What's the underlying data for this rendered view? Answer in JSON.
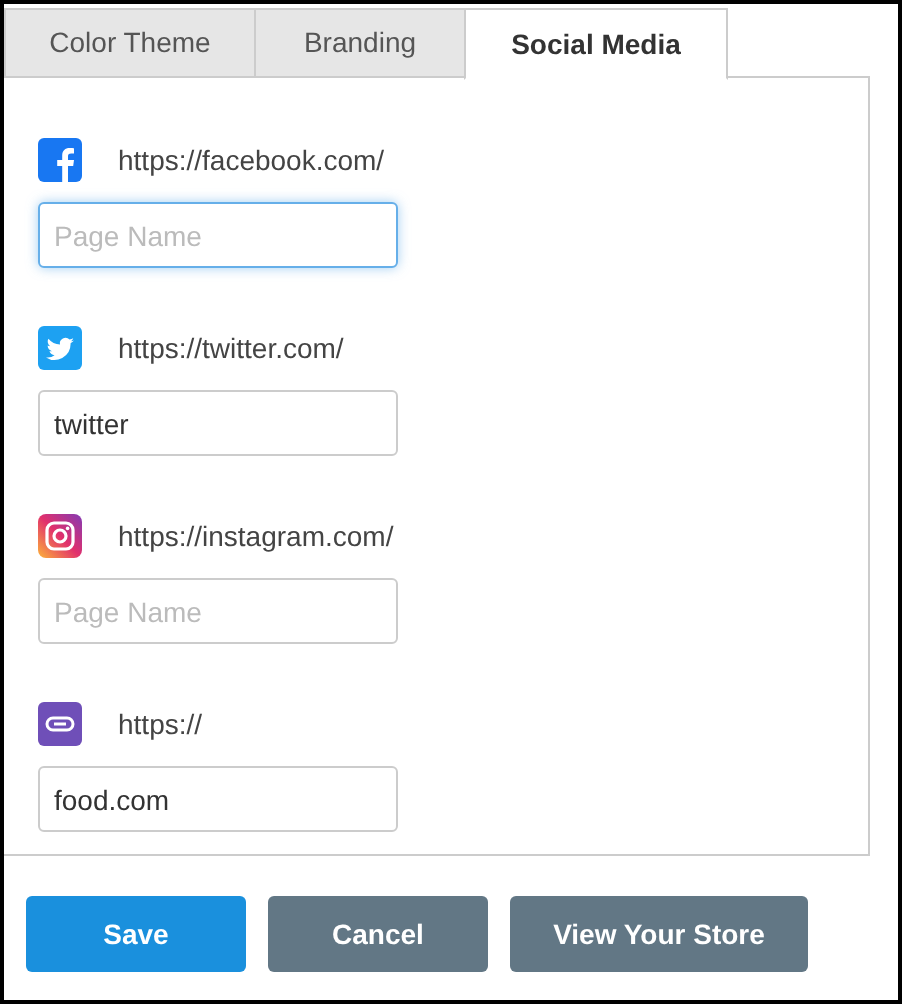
{
  "tabs": [
    {
      "label": "Color Theme",
      "selected": false
    },
    {
      "label": "Branding",
      "selected": false
    },
    {
      "label": "Social Media",
      "selected": true
    }
  ],
  "social_links": [
    {
      "kind": "facebook",
      "prefix": "https://facebook.com/",
      "placeholder": "Page Name",
      "focused": true
    },
    {
      "kind": "twitter",
      "prefix": "https://twitter.com/",
      "value": "twitter",
      "focused": false
    },
    {
      "kind": "instagram",
      "prefix": "https://instagram.com/",
      "placeholder": "Page Name",
      "focused": false
    },
    {
      "kind": "link",
      "prefix": "https://",
      "value": "food.com",
      "focused": false
    }
  ],
  "buttons": [
    {
      "label": "Save",
      "kind": "primary"
    },
    {
      "label": "Cancel",
      "kind": "secondary"
    },
    {
      "label": "View Your Store",
      "kind": "secondary"
    }
  ]
}
